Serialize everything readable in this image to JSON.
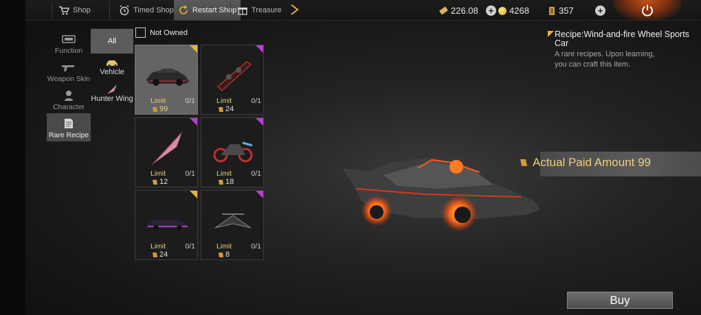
{
  "tabs": [
    {
      "label": "Shop",
      "icon": "cart-icon"
    },
    {
      "label": "Timed Shop",
      "icon": "alarm-clock-icon"
    },
    {
      "label": "Restart Shop",
      "icon": "restart-icon"
    },
    {
      "label": "Treasure",
      "icon": "gift-icon"
    }
  ],
  "currencies": {
    "ticket": "226.08",
    "coins": "4268",
    "tokens": "357"
  },
  "categories": [
    {
      "label": "Function",
      "icon": "function-icon"
    },
    {
      "label": "Weapon Skin",
      "icon": "gun-icon"
    },
    {
      "label": "Character",
      "icon": "character-icon"
    },
    {
      "label": "Rare Recipe",
      "icon": "recipe-icon"
    }
  ],
  "subcategories": [
    {
      "label": "All"
    },
    {
      "label": "Vehicle",
      "icon": "vehicle-icon"
    },
    {
      "label": "Hunter Wing",
      "icon": "wing-icon"
    }
  ],
  "filter": {
    "label": "Not Owned"
  },
  "items": [
    {
      "name": "wind-and-fire-car",
      "limit": "Limit",
      "owned": "0/1",
      "price": "99",
      "rarity": "gold"
    },
    {
      "name": "glider-board",
      "limit": "Limit",
      "owned": "0/1",
      "price": "24",
      "rarity": "purple"
    },
    {
      "name": "blade-wing",
      "limit": "Limit",
      "owned": "0/1",
      "price": "12",
      "rarity": "purple"
    },
    {
      "name": "motorcycle",
      "limit": "Limit",
      "owned": "0/1",
      "price": "18",
      "rarity": "purple"
    },
    {
      "name": "neon-car",
      "limit": "Limit",
      "owned": "0/1",
      "price": "24",
      "rarity": "gold"
    },
    {
      "name": "drone-wing",
      "limit": "Limit",
      "owned": "0/1",
      "price": "8",
      "rarity": "purple"
    }
  ],
  "detail": {
    "title": "Recipe:Wind-and-fire Wheel Sports Car",
    "desc_line1": "A rare recipes. Upon learning,",
    "desc_line2": "you can craft this item.",
    "paid_amount": "Actual Paid Amount 99"
  },
  "buy_label": "Buy",
  "colors": {
    "gold_accent": "#e4b53a",
    "purple_rarity": "#b93fd6",
    "paid_text": "#f1cf79"
  }
}
